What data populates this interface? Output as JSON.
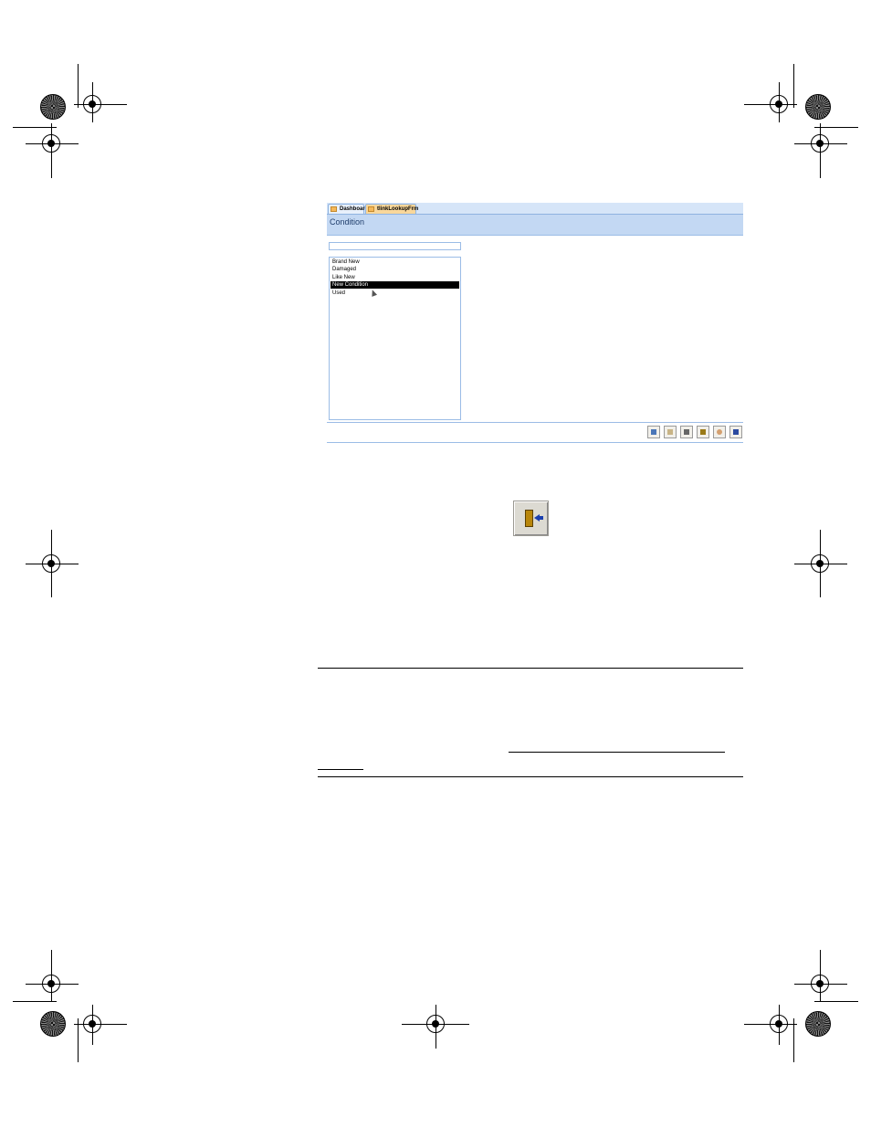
{
  "tabs": [
    {
      "label": "Dashboard"
    },
    {
      "label": "tlinkLookupFrm"
    }
  ],
  "form": {
    "title": "Condition",
    "filter_value": "",
    "list_items": [
      "Brand New",
      "Damaged",
      "Like New",
      "New Condition",
      "Used"
    ],
    "selected_item": "New Condition"
  },
  "toolbar": {
    "buttons": [
      {
        "icon": "new-record-icon"
      },
      {
        "icon": "edit-icon"
      },
      {
        "icon": "save-icon"
      },
      {
        "icon": "delete-icon"
      },
      {
        "icon": "undo-icon"
      },
      {
        "icon": "close-form-icon"
      }
    ]
  },
  "exit_button": {
    "icon": "exit-door-icon"
  }
}
